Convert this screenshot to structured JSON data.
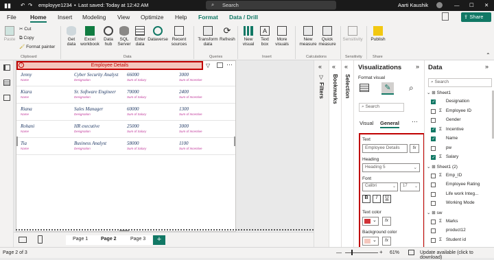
{
  "titlebar": {
    "filename": "employye1234",
    "saved": "Last saved: Today at 12:42 AM",
    "search": "Search",
    "user": "Aarti Kaushik"
  },
  "tabs": [
    "File",
    "Home",
    "Insert",
    "Modeling",
    "View",
    "Optimize",
    "Help",
    "Format",
    "Data / Drill"
  ],
  "ribbon": {
    "paste": "Paste",
    "cut": "Cut",
    "copy": "Copy",
    "format_painter": "Format painter",
    "clipboard": "Clipboard",
    "get_data": "Get\ndata",
    "excel": "Excel\nworkbook",
    "data_hub": "Data\nhub",
    "sql": "SQL\nServer",
    "enter_data": "Enter\ndata",
    "dataverse": "Dataverse",
    "recent": "Recent\nsources",
    "data": "Data",
    "transform": "Transform\ndata",
    "refresh": "Refresh",
    "queries": "Queries",
    "new_visual": "New\nvisual",
    "text_box": "Text\nbox",
    "more_visuals": "More\nvisuals",
    "insert": "Insert",
    "new_measure": "New\nmeasure",
    "quick_measure": "Quick\nmeasure",
    "calculations": "Calculations",
    "sensitivity": "Sensitivity",
    "sensitivity_grp": "Sensitivity",
    "publish": "Publish",
    "share_grp": "Share",
    "share": "Share"
  },
  "visual": {
    "title": "Employee Details",
    "rows": [
      {
        "name": "Jenny",
        "designation": "Cyber Security Analyst",
        "salary": "66000",
        "incentive": "3000"
      },
      {
        "name": "Kiara",
        "designation": "Sr. Software Engineer",
        "salary": "70000",
        "incentive": "2400"
      },
      {
        "name": "Riana",
        "designation": "Sales Manager",
        "salary": "60000",
        "incentive": "1300"
      },
      {
        "name": "Rohani",
        "designation": "HR executive",
        "salary": "25000",
        "incentive": "3000"
      },
      {
        "name": "Tia",
        "designation": "Business Analyst",
        "salary": "58000",
        "incentive": "1100"
      }
    ],
    "sub": {
      "name": "Name",
      "designation": "Designation",
      "salary": "Sum of Salary",
      "incentive": "Sum of Incentive"
    }
  },
  "pages": [
    "Page 1",
    "Page 2",
    "Page 3"
  ],
  "status": {
    "page": "Page 2 of 3",
    "zoom": "61%",
    "update": "Update available (click to download)"
  },
  "panes": {
    "filters": "Filters",
    "bookmarks": "Bookmarks",
    "selection": "Selection"
  },
  "viz": {
    "title": "Visualizations",
    "format_visual": "Format visual",
    "search": "Search",
    "tab_visual": "Visual",
    "tab_general": "General",
    "text_label": "Text",
    "text_value": "Employee Details",
    "fx": "fx",
    "heading_label": "Heading",
    "heading_value": "Heading 5",
    "font_label": "Font",
    "font_value": "Calibri",
    "font_size": "17",
    "bold": "B",
    "italic": "I",
    "underline": "U",
    "text_color": "Text color",
    "bg_color": "Background color",
    "text_color_hex": "#d13438",
    "bg_color_hex": "#f4c7bd"
  },
  "datapane": {
    "title": "Data",
    "search": "Search",
    "sheet1": "Sheet1",
    "sheet1_fields": [
      {
        "label": "Designation",
        "sigma": false,
        "on": true
      },
      {
        "label": "Employee ID",
        "sigma": true,
        "on": false
      },
      {
        "label": "Gender",
        "sigma": false,
        "on": false
      },
      {
        "label": "Incentive",
        "sigma": true,
        "on": true
      },
      {
        "label": "Name",
        "sigma": false,
        "on": true
      },
      {
        "label": "pw",
        "sigma": false,
        "on": false
      },
      {
        "label": "Salary",
        "sigma": true,
        "on": true
      }
    ],
    "sheet1_2": "Sheet1 (2)",
    "sheet1_2_fields": [
      {
        "label": "Emp_ID",
        "sigma": true
      },
      {
        "label": "Employee Rating",
        "sigma": false
      },
      {
        "label": "Life work Integ...",
        "sigma": false
      },
      {
        "label": "Working Mode",
        "sigma": false
      }
    ],
    "sw": "sw",
    "sw_fields": [
      {
        "label": "Marks",
        "sigma": true
      },
      {
        "label": "product12",
        "sigma": false
      },
      {
        "label": "Student id",
        "sigma": true
      }
    ]
  }
}
